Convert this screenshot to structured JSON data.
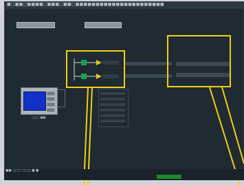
{
  "window": {
    "title": "",
    "title_text": "■□■■□■■■■□■■■□■■□■■■■■■■■■■■■■■■■■■■■■■"
  },
  "toolbar": {
    "button1_label": "",
    "button2_label": ""
  },
  "device": {
    "label": "□□□ ■■"
  },
  "labels": {
    "middle": "",
    "right": ""
  },
  "status": {
    "line1": "■■ □□□ □□□ ■ ■",
    "line2": "",
    "right": ""
  },
  "colors": {
    "accent": "#f4cf12",
    "screen_bg": "#1f2a33",
    "device_screen": "#1232c7",
    "status_green": "#1d8a2a"
  }
}
